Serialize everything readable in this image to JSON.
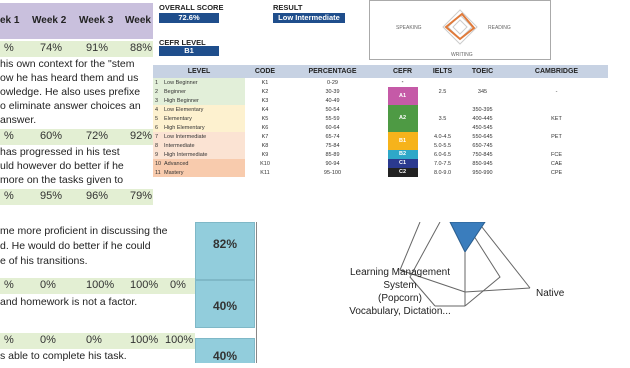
{
  "spreadsheet": {
    "week_headers": [
      "ek 1",
      "Week 2",
      "Week 3",
      "Week"
    ],
    "rows": [
      {
        "values": [
          "%",
          "74%",
          "91%",
          "88%"
        ],
        "lines": [
          " his own context for the \"stem",
          "ow he has heard them and us",
          "owledge. He also uses prefixe",
          "o eliminate answer choices an",
          "answer."
        ]
      },
      {
        "values": [
          "%",
          "60%",
          "72%",
          "92%"
        ],
        "lines": [
          " has progressed in his test",
          "uld however do better if he",
          "more on the tasks given to"
        ]
      },
      {
        "values": [
          "%",
          "95%",
          "96%",
          "79%"
        ],
        "lines": [
          "me more proficient in discussing the",
          "d. He would do better if he could",
          "e of his transitions."
        ]
      },
      {
        "values": [
          "%",
          "0%",
          "100%",
          "100%",
          "0%"
        ],
        "lines": [
          "and homework is not a factor."
        ]
      },
      {
        "values": [
          "%",
          "0%",
          "0%",
          "100%",
          "100%"
        ],
        "lines": [
          "s able to complete his task."
        ]
      }
    ],
    "totals": [
      "82%",
      "40%",
      "40%"
    ]
  },
  "report": {
    "overall_score_label": "OVERALL SCORE",
    "overall_score_value": "72.6%",
    "result_label": "RESULT",
    "result_value": "Low Intermediate",
    "cefr_level_label": "CEFR LEVEL",
    "cefr_level_value": "B1",
    "skills": [
      "SPEAKING",
      "READING",
      "WRITING"
    ],
    "table": {
      "headers": [
        "LEVEL",
        "CODE",
        "PERCENTAGE",
        "CEFR",
        "IELTS",
        "TOEIC",
        "CAMBRIDGE"
      ],
      "rows": [
        {
          "n": "1",
          "level": "Low Beginner",
          "code": "K1",
          "pct": "0-29",
          "ielts": "",
          "toeic": "",
          "cambridge": "",
          "color": "#e2efd9"
        },
        {
          "n": "2",
          "level": "Beginner",
          "code": "K2",
          "pct": "30-39",
          "ielts": "2.5",
          "toeic": "345",
          "cambridge": "-",
          "color": "#e2efd9"
        },
        {
          "n": "3",
          "level": "High Beginner",
          "code": "K3",
          "pct": "40-49",
          "ielts": "",
          "toeic": "",
          "cambridge": "",
          "color": "#e2efd9"
        },
        {
          "n": "4",
          "level": "Low Elementary",
          "code": "K4",
          "pct": "50-54",
          "ielts": "",
          "toeic": "350-395",
          "cambridge": "",
          "color": "#fdf1cf"
        },
        {
          "n": "5",
          "level": "Elementary",
          "code": "K5",
          "pct": "55-59",
          "ielts": "3.5",
          "toeic": "400-445",
          "cambridge": "KET",
          "color": "#fdf1cf"
        },
        {
          "n": "6",
          "level": "High Elementary",
          "code": "K6",
          "pct": "60-64",
          "ielts": "",
          "toeic": "450-545",
          "cambridge": "",
          "color": "#fdf1cf"
        },
        {
          "n": "7",
          "level": "Low Intermediate",
          "code": "K7",
          "pct": "65-74",
          "ielts": "4.0-4.5",
          "toeic": "550-645",
          "cambridge": "PET",
          "color": "#fbe3d3"
        },
        {
          "n": "8",
          "level": "Intermediate",
          "code": "K8",
          "pct": "75-84",
          "ielts": "5.0-5.5",
          "toeic": "650-745",
          "cambridge": "",
          "color": "#fbe3d3"
        },
        {
          "n": "9",
          "level": "High Intermediate",
          "code": "K9",
          "pct": "85-89",
          "ielts": "6.0-6.5",
          "toeic": "750-845",
          "cambridge": "FCE",
          "color": "#fbe3d3"
        },
        {
          "n": "10",
          "level": "Advanced",
          "code": "K10",
          "pct": "90-94",
          "ielts": "7.0-7.5",
          "toeic": "850-945",
          "cambridge": "CAE",
          "color": "#f8cbad"
        },
        {
          "n": "11",
          "level": "Mastery",
          "code": "K11",
          "pct": "95-100",
          "ielts": "8.0-9.0",
          "toeic": "950-990",
          "cambridge": "CPE",
          "color": "#f8cbad"
        }
      ],
      "cefr_blocks": [
        {
          "label": "-",
          "color": "#ffffff",
          "text_color": "#333333"
        },
        {
          "label": "A1",
          "color": "#c55aa7",
          "text_color": "#ffffff"
        },
        {
          "label": "A2",
          "color": "#4e9a44",
          "text_color": "#ffffff"
        },
        {
          "label": "B1",
          "color": "#f6b31b",
          "text_color": "#ffffff"
        },
        {
          "label": "B2",
          "color": "#2ea8c8",
          "text_color": "#ffffff"
        },
        {
          "label": "C1",
          "color": "#2b3a8f",
          "text_color": "#ffffff"
        },
        {
          "label": "C2",
          "color": "#222222",
          "text_color": "#ffffff"
        }
      ]
    }
  },
  "radar": {
    "label_left": [
      "Learning Management",
      "System",
      "(Popcorn)",
      "Vocabulary, Dictation..."
    ],
    "label_right": "Native"
  },
  "colors": {
    "score_box": "#1f4e8c",
    "header_purple": "#c9c0dd",
    "row_green": "#e3efd3",
    "total_cell": "#92cddc",
    "radar_fill": "#3a7dbd"
  }
}
